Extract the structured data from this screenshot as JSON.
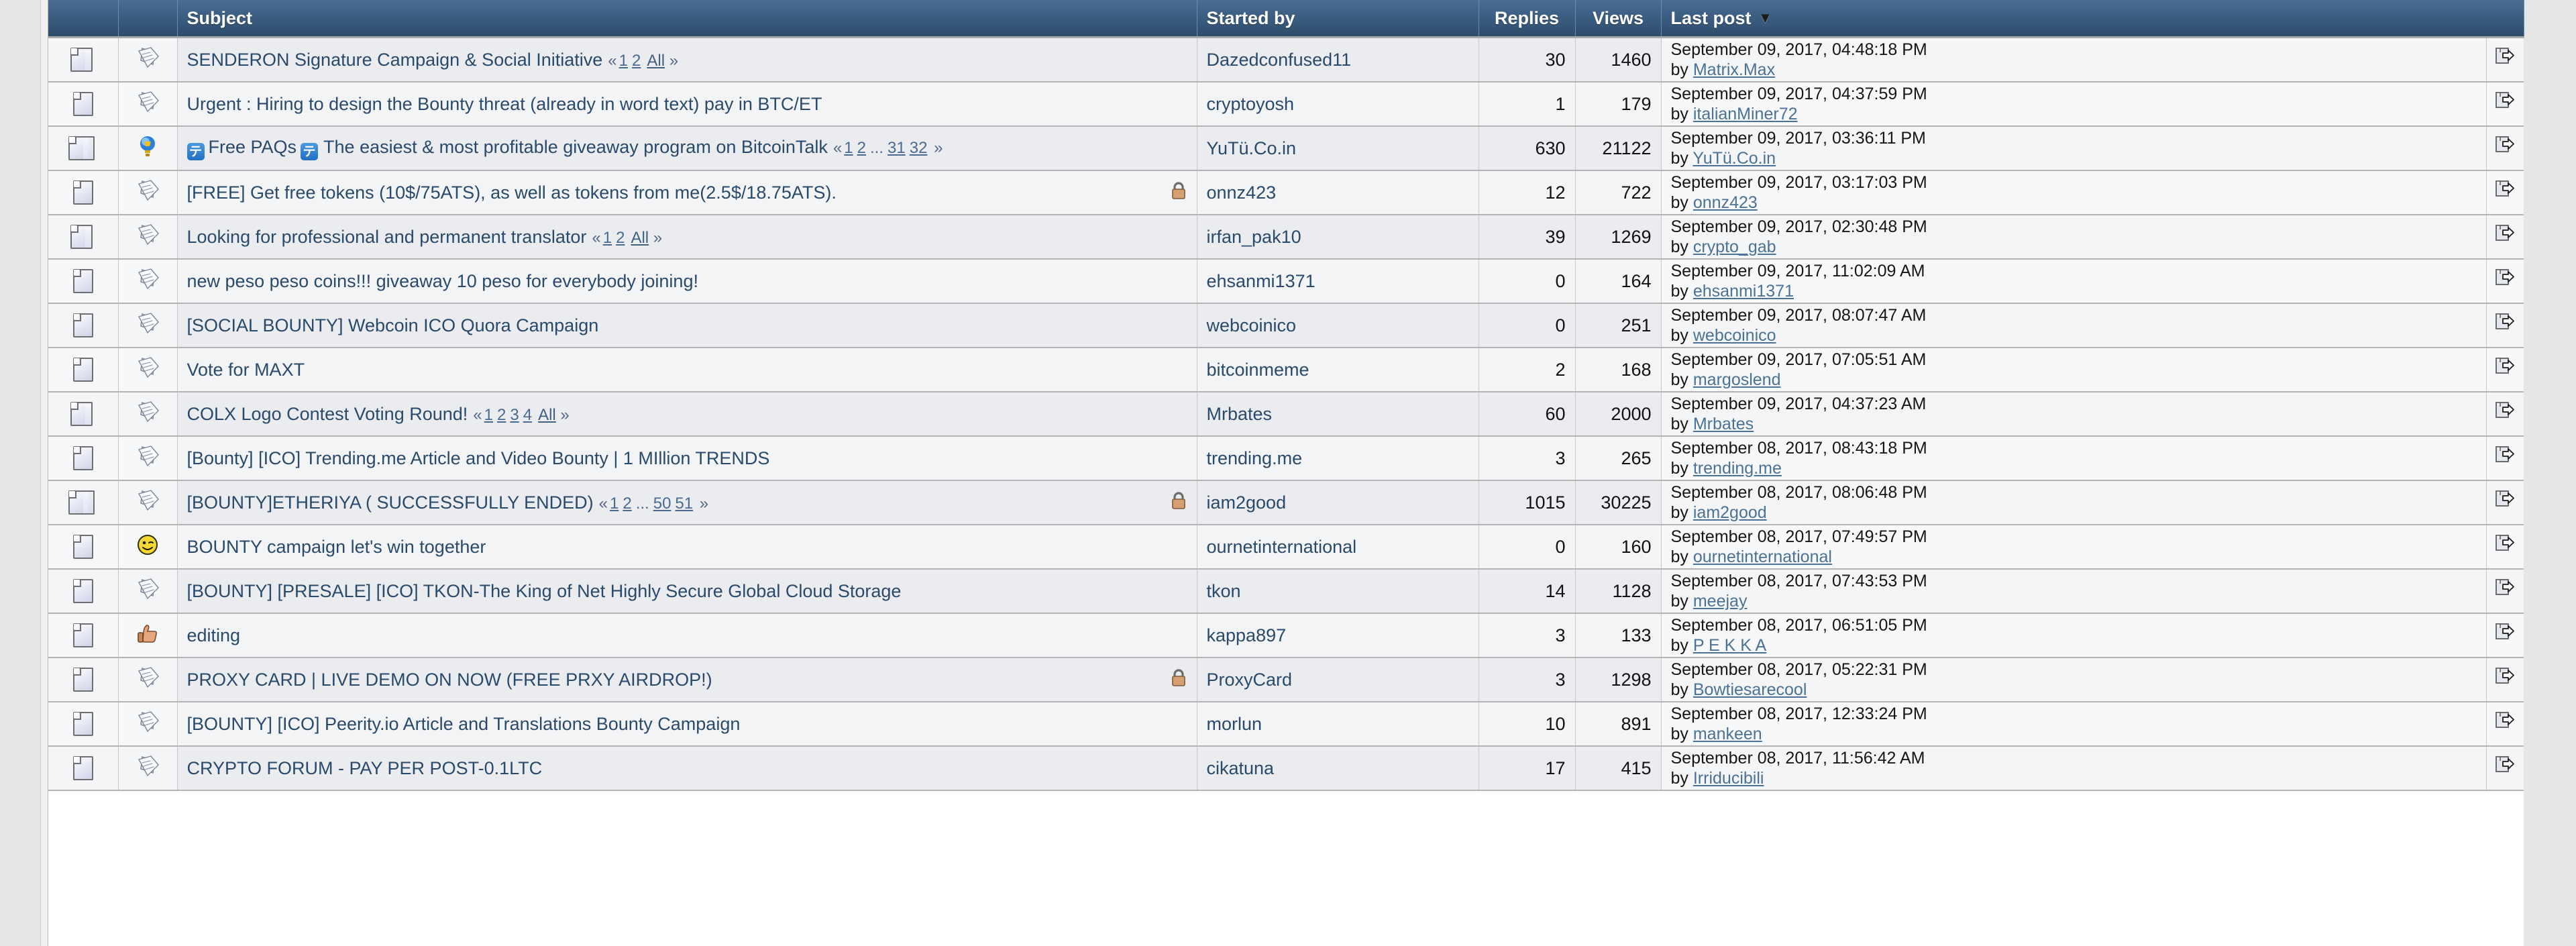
{
  "table": {
    "columns": [
      {
        "key": "icon_state",
        "label": ""
      },
      {
        "key": "icon_topic",
        "label": ""
      },
      {
        "key": "subject",
        "label": "Subject"
      },
      {
        "key": "started_by",
        "label": "Started by"
      },
      {
        "key": "replies",
        "label": "Replies"
      },
      {
        "key": "views",
        "label": "Views"
      },
      {
        "key": "last_post",
        "label": "Last post"
      },
      {
        "key": "jump",
        "label": ""
      }
    ],
    "sort": {
      "column": "Last post",
      "indicator": "▼",
      "direction": "desc"
    },
    "rows": [
      {
        "state_icon": "multi-page-icon",
        "topic_icon": "message-icon",
        "subject": "SENDERON Signature Campaign & Social Initiative",
        "pages": [
          "1",
          "2"
        ],
        "pages_all": "All",
        "locked": false,
        "started_by": "Dazedconfused11",
        "replies": "30",
        "views": "1460",
        "last_post_date": "September 09, 2017, 04:48:18 PM",
        "last_post_by_prefix": "by",
        "last_post_by": "Matrix.Max"
      },
      {
        "state_icon": "single-page-icon",
        "topic_icon": "message-icon",
        "subject": "Urgent : Hiring to design the Bounty threat (already in word text) pay in BTC/ET",
        "pages": [],
        "pages_all": "",
        "locked": false,
        "started_by": "cryptoyosh",
        "replies": "1",
        "views": "179",
        "last_post_date": "September 09, 2017, 04:37:59 PM",
        "last_post_by_prefix": "by",
        "last_post_by": "italianMiner72"
      },
      {
        "state_icon": "hot-multi-page-icon",
        "topic_icon": "bulb-icon",
        "subject_prefix_emoji": "🈁",
        "subject_part1": "Free PAQs",
        "subject_part2": "The easiest & most profitable giveaway program on BitcoinTalk",
        "subject": "Free PAQs The easiest & most profitable giveaway program on BitcoinTalk",
        "pages": [
          "1",
          "2",
          "...",
          "31",
          "32"
        ],
        "pages_all": "",
        "locked": false,
        "started_by": "YuTü.Co.in",
        "replies": "630",
        "views": "21122",
        "last_post_date": "September 09, 2017, 03:36:11 PM",
        "last_post_by_prefix": "by",
        "last_post_by": "YuTü.Co.in"
      },
      {
        "state_icon": "single-page-icon",
        "topic_icon": "message-icon",
        "subject": "[FREE] Get free tokens (10$/75ATS), as well as tokens from me(2.5$/18.75ATS).",
        "pages": [],
        "pages_all": "",
        "locked": true,
        "started_by": "onnz423",
        "replies": "12",
        "views": "722",
        "last_post_date": "September 09, 2017, 03:17:03 PM",
        "last_post_by_prefix": "by",
        "last_post_by": "onnz423"
      },
      {
        "state_icon": "multi-page-icon",
        "topic_icon": "message-icon",
        "subject": "Looking for professional and permanent translator",
        "pages": [
          "1",
          "2"
        ],
        "pages_all": "All",
        "locked": false,
        "started_by": "irfan_pak10",
        "replies": "39",
        "views": "1269",
        "last_post_date": "September 09, 2017, 02:30:48 PM",
        "last_post_by_prefix": "by",
        "last_post_by": "crypto_gab"
      },
      {
        "state_icon": "single-page-icon",
        "topic_icon": "message-icon",
        "subject": "new peso peso coins!!! giveaway 10 peso for everybody joining!",
        "pages": [],
        "pages_all": "",
        "locked": false,
        "started_by": "ehsanmi1371",
        "replies": "0",
        "views": "164",
        "last_post_date": "September 09, 2017, 11:02:09 AM",
        "last_post_by_prefix": "by",
        "last_post_by": "ehsanmi1371"
      },
      {
        "state_icon": "single-page-icon",
        "topic_icon": "message-icon",
        "subject": "[SOCIAL BOUNTY] Webcoin ICO Quora Campaign",
        "pages": [],
        "pages_all": "",
        "locked": false,
        "started_by": "webcoinico",
        "replies": "0",
        "views": "251",
        "last_post_date": "September 09, 2017, 08:07:47 AM",
        "last_post_by_prefix": "by",
        "last_post_by": "webcoinico"
      },
      {
        "state_icon": "single-page-icon",
        "topic_icon": "message-icon",
        "subject": "Vote for MAXT",
        "pages": [],
        "pages_all": "",
        "locked": false,
        "started_by": "bitcoinmeme",
        "replies": "2",
        "views": "168",
        "last_post_date": "September 09, 2017, 07:05:51 AM",
        "last_post_by_prefix": "by",
        "last_post_by": "margoslend"
      },
      {
        "state_icon": "multi-page-icon",
        "topic_icon": "message-icon",
        "subject": "COLX Logo Contest Voting Round!",
        "pages": [
          "1",
          "2",
          "3",
          "4"
        ],
        "pages_all": "All",
        "locked": false,
        "started_by": "Mrbates",
        "replies": "60",
        "views": "2000",
        "last_post_date": "September 09, 2017, 04:37:23 AM",
        "last_post_by_prefix": "by",
        "last_post_by": "Mrbates"
      },
      {
        "state_icon": "single-page-icon",
        "topic_icon": "message-icon",
        "subject": "[Bounty] [ICO] Trending.me Article and Video Bounty | 1 MIllion TRENDS",
        "pages": [],
        "pages_all": "",
        "locked": false,
        "started_by": "trending.me",
        "replies": "3",
        "views": "265",
        "last_post_date": "September 08, 2017, 08:43:18 PM",
        "last_post_by_prefix": "by",
        "last_post_by": "trending.me"
      },
      {
        "state_icon": "hot-multi-page-icon",
        "topic_icon": "message-icon",
        "subject": "[BOUNTY]ETHERIYA ( SUCCESSFULLY ENDED)",
        "pages": [
          "1",
          "2",
          "...",
          "50",
          "51"
        ],
        "pages_all": "",
        "locked": true,
        "started_by": "iam2good",
        "replies": "1015",
        "views": "30225",
        "last_post_date": "September 08, 2017, 08:06:48 PM",
        "last_post_by_prefix": "by",
        "last_post_by": "iam2good"
      },
      {
        "state_icon": "single-page-icon",
        "topic_icon": "smiley-wink-icon",
        "subject": "BOUNTY campaign let's win together",
        "pages": [],
        "pages_all": "",
        "locked": false,
        "started_by": "ournetinternational",
        "replies": "0",
        "views": "160",
        "last_post_date": "September 08, 2017, 07:49:57 PM",
        "last_post_by_prefix": "by",
        "last_post_by": "ournetinternational"
      },
      {
        "state_icon": "single-page-icon",
        "topic_icon": "message-icon",
        "subject": "[BOUNTY] [PRESALE] [ICO] TKON-The King of Net Highly Secure Global Cloud Storage",
        "pages": [],
        "pages_all": "",
        "locked": false,
        "started_by": "tkon",
        "replies": "14",
        "views": "1128",
        "last_post_date": "September 08, 2017, 07:43:53 PM",
        "last_post_by_prefix": "by",
        "last_post_by": "meejay"
      },
      {
        "state_icon": "single-page-icon",
        "topic_icon": "thumbs-up-icon",
        "subject": "editing",
        "pages": [],
        "pages_all": "",
        "locked": false,
        "started_by": "kappa897",
        "replies": "3",
        "views": "133",
        "last_post_date": "September 08, 2017, 06:51:05 PM",
        "last_post_by_prefix": "by",
        "last_post_by": "P E K K A"
      },
      {
        "state_icon": "single-page-icon",
        "topic_icon": "message-icon",
        "subject": "PROXY CARD | LIVE DEMO ON NOW (FREE PRXY AIRDROP!)",
        "pages": [],
        "pages_all": "",
        "locked": true,
        "started_by": "ProxyCard",
        "replies": "3",
        "views": "1298",
        "last_post_date": "September 08, 2017, 05:22:31 PM",
        "last_post_by_prefix": "by",
        "last_post_by": "Bowtiesarecool"
      },
      {
        "state_icon": "single-page-icon",
        "topic_icon": "message-icon",
        "subject": "[BOUNTY] [ICO] Peerity.io Article and Translations Bounty Campaign",
        "pages": [],
        "pages_all": "",
        "locked": false,
        "started_by": "morlun",
        "replies": "10",
        "views": "891",
        "last_post_date": "September 08, 2017, 12:33:24 PM",
        "last_post_by_prefix": "by",
        "last_post_by": "mankeen"
      },
      {
        "state_icon": "single-page-icon",
        "topic_icon": "message-icon",
        "subject": "CRYPTO FORUM - PAY PER POST-0.1LTC",
        "pages": [],
        "pages_all": "",
        "locked": false,
        "started_by": "cikatuna",
        "replies": "17",
        "views": "415",
        "last_post_date": "September 08, 2017, 11:56:42 AM",
        "last_post_by_prefix": "by",
        "last_post_by": "Irriducibili"
      }
    ]
  },
  "colors": {
    "header_gradient_top": "#4d6e93",
    "header_gradient_bottom": "#2d4a69",
    "header_text": "#ffffff",
    "row_bg": "#eaecef",
    "row_bg_alt": "#f3f4f6",
    "link_text": "#2a4a6b",
    "page_bg": "#e6e6e6"
  },
  "glyphs": {
    "guillemet_left": "«",
    "guillemet_right": "»",
    "ellipsis": "…"
  }
}
